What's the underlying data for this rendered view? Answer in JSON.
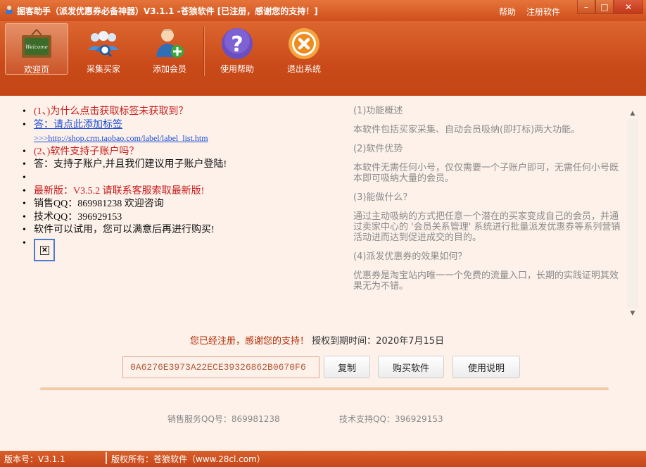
{
  "window": {
    "title": "掘客助手（派发优惠券必备神器）V3.1.1  -苍狼软件 [已注册，感谢您的支持！]",
    "links": [
      "帮助",
      "注册软件"
    ],
    "controls": {
      "minimize": "–",
      "maximize": "□",
      "close": "✕"
    }
  },
  "toolbar": {
    "items": [
      {
        "label": "欢迎页",
        "icon": "welcome-board-icon"
      },
      {
        "label": "采集买家",
        "icon": "users-search-icon"
      },
      {
        "label": "添加会员",
        "icon": "add-user-icon"
      },
      {
        "label": "使用帮助",
        "icon": "help-question-icon"
      },
      {
        "label": "退出系统",
        "icon": "exit-close-icon"
      }
    ]
  },
  "left_list": [
    {
      "text": "(1、)为什么点击获取标签未获取到？",
      "style": "red"
    },
    {
      "text": "答：请点此添加标签",
      "style": "link"
    },
    {
      "text": ">>>http://shop.crm.taobao.com/label/label_list.htm",
      "style": "link-small"
    },
    {
      "text": "(2、)软件支持子账户吗？",
      "style": "red"
    },
    {
      "text": "答：支持子账户,并且我们建议用子账户登陆!",
      "style": "black"
    },
    {
      "text": "",
      "style": "black"
    },
    {
      "text": "最新版：V3.5.2 请联系客服索取最新版!",
      "style": "red"
    },
    {
      "text": "销售QQ：869981238 欢迎咨询",
      "style": "black"
    },
    {
      "text": "技术QQ：396929153",
      "style": "black"
    },
    {
      "text": "软件可以试用，您可以满意后再进行购买!",
      "style": "black"
    }
  ],
  "right_pane": [
    {
      "heading": "(1)功能概述",
      "body": "本软件包括买家采集、自动会员吸纳(即打标)两大功能。"
    },
    {
      "heading": "(2)软件优势",
      "body": "本软件无需任何小号，仅仅需要一个子账户即可，无需任何小号既本即可吸纳大量的会员。"
    },
    {
      "heading": "(3)能做什么？",
      "body": "通过主动吸纳的方式把任意一个潜在的买家变成自己的会员，并通过卖家中心的 '会员关系管理' 系统进行批量派发优惠券等系列营销活动进而达到促进成交的目的。"
    },
    {
      "heading": "(4)派发优惠券的效果如何？",
      "body": "优惠券是淘宝站内唯一一个免费的流量入口，长期的实践证明其效果无为不错。"
    }
  ],
  "registration": {
    "thanks": "您已经注册，感谢您的支持！",
    "expiry_label": "授权到期时间：",
    "expiry_date": "2020年7月15日",
    "serial": "0A6276E3973A22ECE39326862B0670F6"
  },
  "buttons": {
    "copy": "复制",
    "buy": "购买软件",
    "manual": "使用说明"
  },
  "contacts": {
    "sales": "销售服务QQ号：869981238",
    "tech": "技术支持QQ：396929153"
  },
  "status": {
    "version": "版本号：V3.1.1",
    "copyright": "版权所有：苍狼软件（www.28cl.com）"
  }
}
